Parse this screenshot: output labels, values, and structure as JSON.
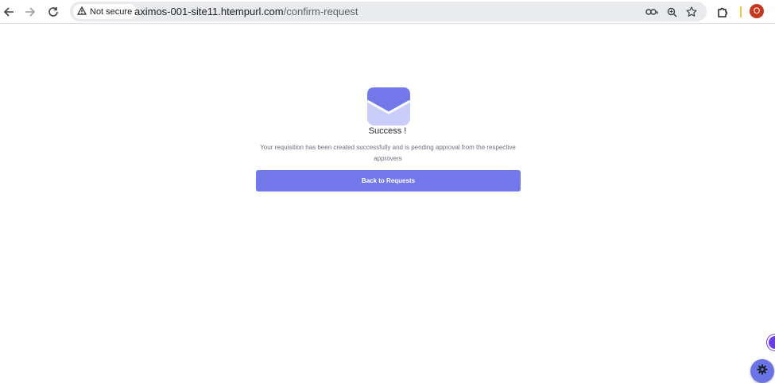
{
  "browser": {
    "security_label": "Not secure",
    "url_host": "aximos-001-site11.htempurl.com",
    "url_path": "/confirm-request",
    "profile_initial": "O"
  },
  "main": {
    "title": "Success !",
    "message": "Your requisition has been created successfully and is pending approval from the respective approvers",
    "button_label": "Back to Requests"
  },
  "colors": {
    "accent": "#7277e9",
    "envelope_light": "#c9cdf7",
    "envelope_dark": "#7277e9"
  },
  "icons": {
    "back": "arrow-left-icon",
    "forward": "arrow-right-icon",
    "reload": "reload-icon",
    "warning": "warning-triangle-icon",
    "password": "key-icon",
    "zoom": "zoom-icon",
    "bookmark": "star-icon",
    "extensions": "puzzle-icon",
    "settings": "gear-icon"
  }
}
